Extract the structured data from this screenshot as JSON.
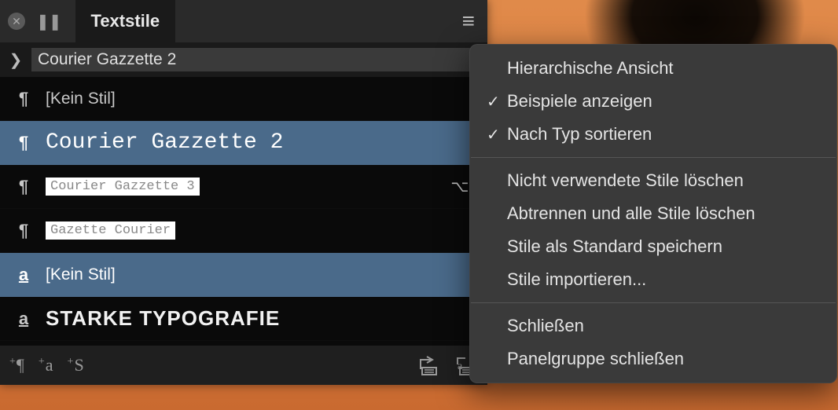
{
  "panel": {
    "title": "Textstile",
    "search_value": "Courier Gazzette 2",
    "styles": [
      {
        "icon": "¶",
        "icon_type": "para",
        "name": "[Kein Stil]",
        "selected": false,
        "variant": "plain",
        "shortcut": ""
      },
      {
        "icon": "¶",
        "icon_type": "para",
        "name": "Courier Gazzette 2",
        "selected": true,
        "variant": "courier-big",
        "shortcut": ""
      },
      {
        "icon": "¶",
        "icon_type": "para",
        "name": "Courier Gazzette 3",
        "selected": false,
        "variant": "highlight",
        "shortcut": "⌥,"
      },
      {
        "icon": "¶",
        "icon_type": "para",
        "name": "Gazette Courier",
        "selected": false,
        "variant": "highlight",
        "shortcut": ""
      },
      {
        "icon": "a",
        "icon_type": "char",
        "name": "[Kein Stil]",
        "selected": true,
        "variant": "plain",
        "shortcut": ""
      },
      {
        "icon": "a",
        "icon_type": "char",
        "name": "STARKE TYPOGRAFIE",
        "selected": false,
        "variant": "bold-heavy",
        "shortcut": ""
      }
    ],
    "footer_buttons": {
      "add_paragraph": "¶",
      "add_character": "a",
      "add_style": "S"
    }
  },
  "context_menu": {
    "groups": [
      [
        {
          "label": "Hierarchische Ansicht",
          "checked": false
        },
        {
          "label": "Beispiele anzeigen",
          "checked": true
        },
        {
          "label": "Nach Typ sortieren",
          "checked": true
        }
      ],
      [
        {
          "label": "Nicht verwendete Stile löschen",
          "checked": false
        },
        {
          "label": "Abtrennen und alle Stile löschen",
          "checked": false
        },
        {
          "label": "Stile als Standard speichern",
          "checked": false
        },
        {
          "label": "Stile importieren...",
          "checked": false
        }
      ],
      [
        {
          "label": "Schließen",
          "checked": false
        },
        {
          "label": "Panelgruppe schließen",
          "checked": false
        }
      ]
    ]
  }
}
